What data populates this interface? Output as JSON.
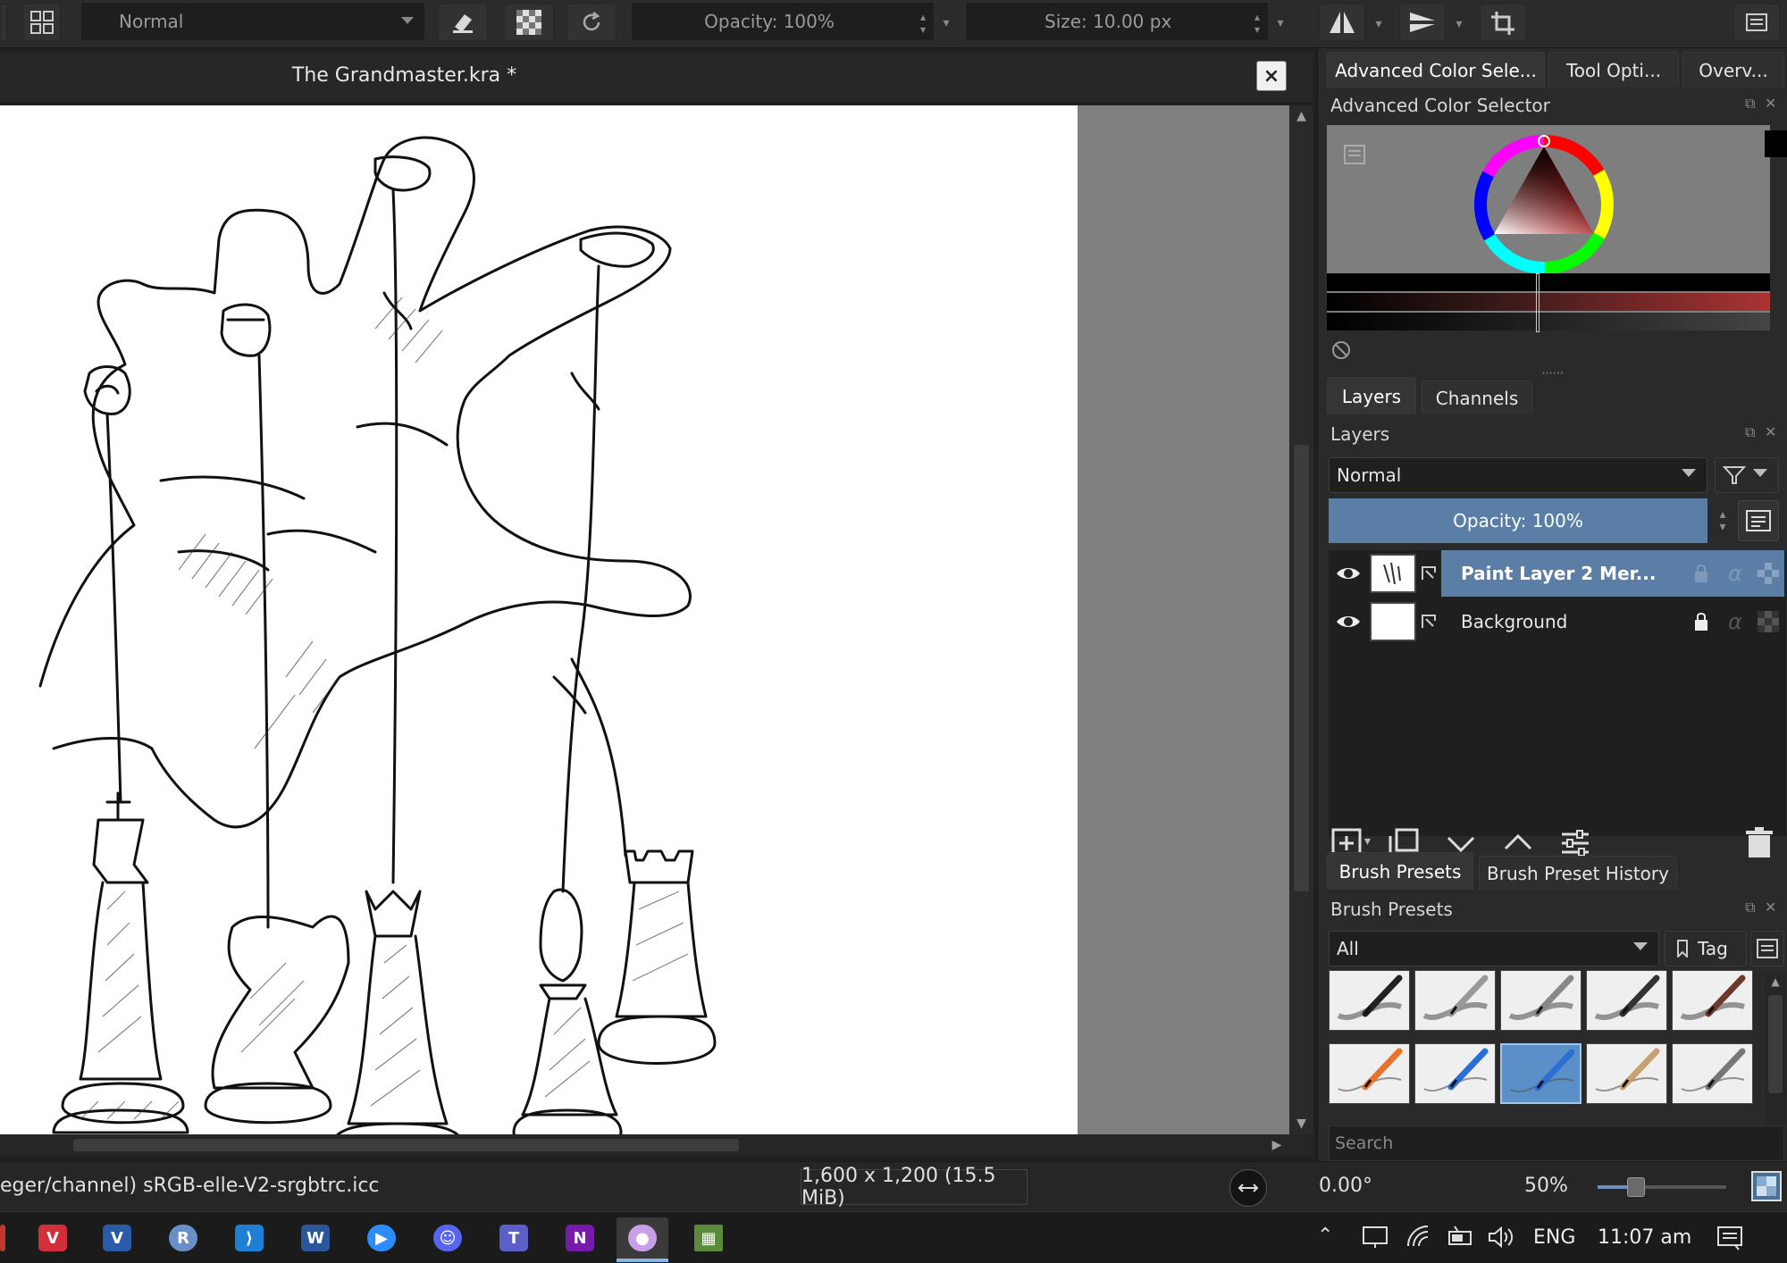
{
  "toolbar": {
    "blend_mode": "Normal",
    "opacity": "Opacity: 100%",
    "size": "Size: 10.00 px"
  },
  "document": {
    "title": "The Grandmaster.kra *",
    "close_label": "×"
  },
  "dock": {
    "top_tabs": [
      "Advanced Color Sele...",
      "Tool Opti...",
      "Overv..."
    ],
    "color_selector_title": "Advanced Color Selector",
    "layers_tabs": [
      "Layers",
      "Channels"
    ],
    "layers_title": "Layers",
    "layer_blend_mode": "Normal",
    "layer_opacity": "Opacity:  100%",
    "layers": [
      {
        "name": "Paint Layer 2 Mer...",
        "selected": true
      },
      {
        "name": "Background",
        "selected": false
      }
    ],
    "brush_tabs": [
      "Brush Presets",
      "Brush Preset History"
    ],
    "brush_title": "Brush Presets",
    "brush_filter": "All",
    "brush_tag": "Tag",
    "brush_search_placeholder": "Search"
  },
  "status": {
    "profile": "eger/channel)  sRGB-elle-V2-srgbtrc.icc",
    "dimensions": "1,600 x 1,200 (15.5 MiB)",
    "rotation": "0.00°",
    "zoom": "50%",
    "zoom_slider_fraction": 0.3
  },
  "taskbar": {
    "apps": [
      "vivaldi",
      "visio",
      "r",
      "vscode",
      "word",
      "zoom",
      "discord",
      "teams",
      "onenote",
      "krita",
      "minecraft"
    ],
    "language": "ENG",
    "time": "11:07 am"
  },
  "colors": {
    "selection_blue": "#5a7ea6",
    "panel_bg": "#2a2a2a",
    "canvas_gray": "#7f7f7f"
  }
}
